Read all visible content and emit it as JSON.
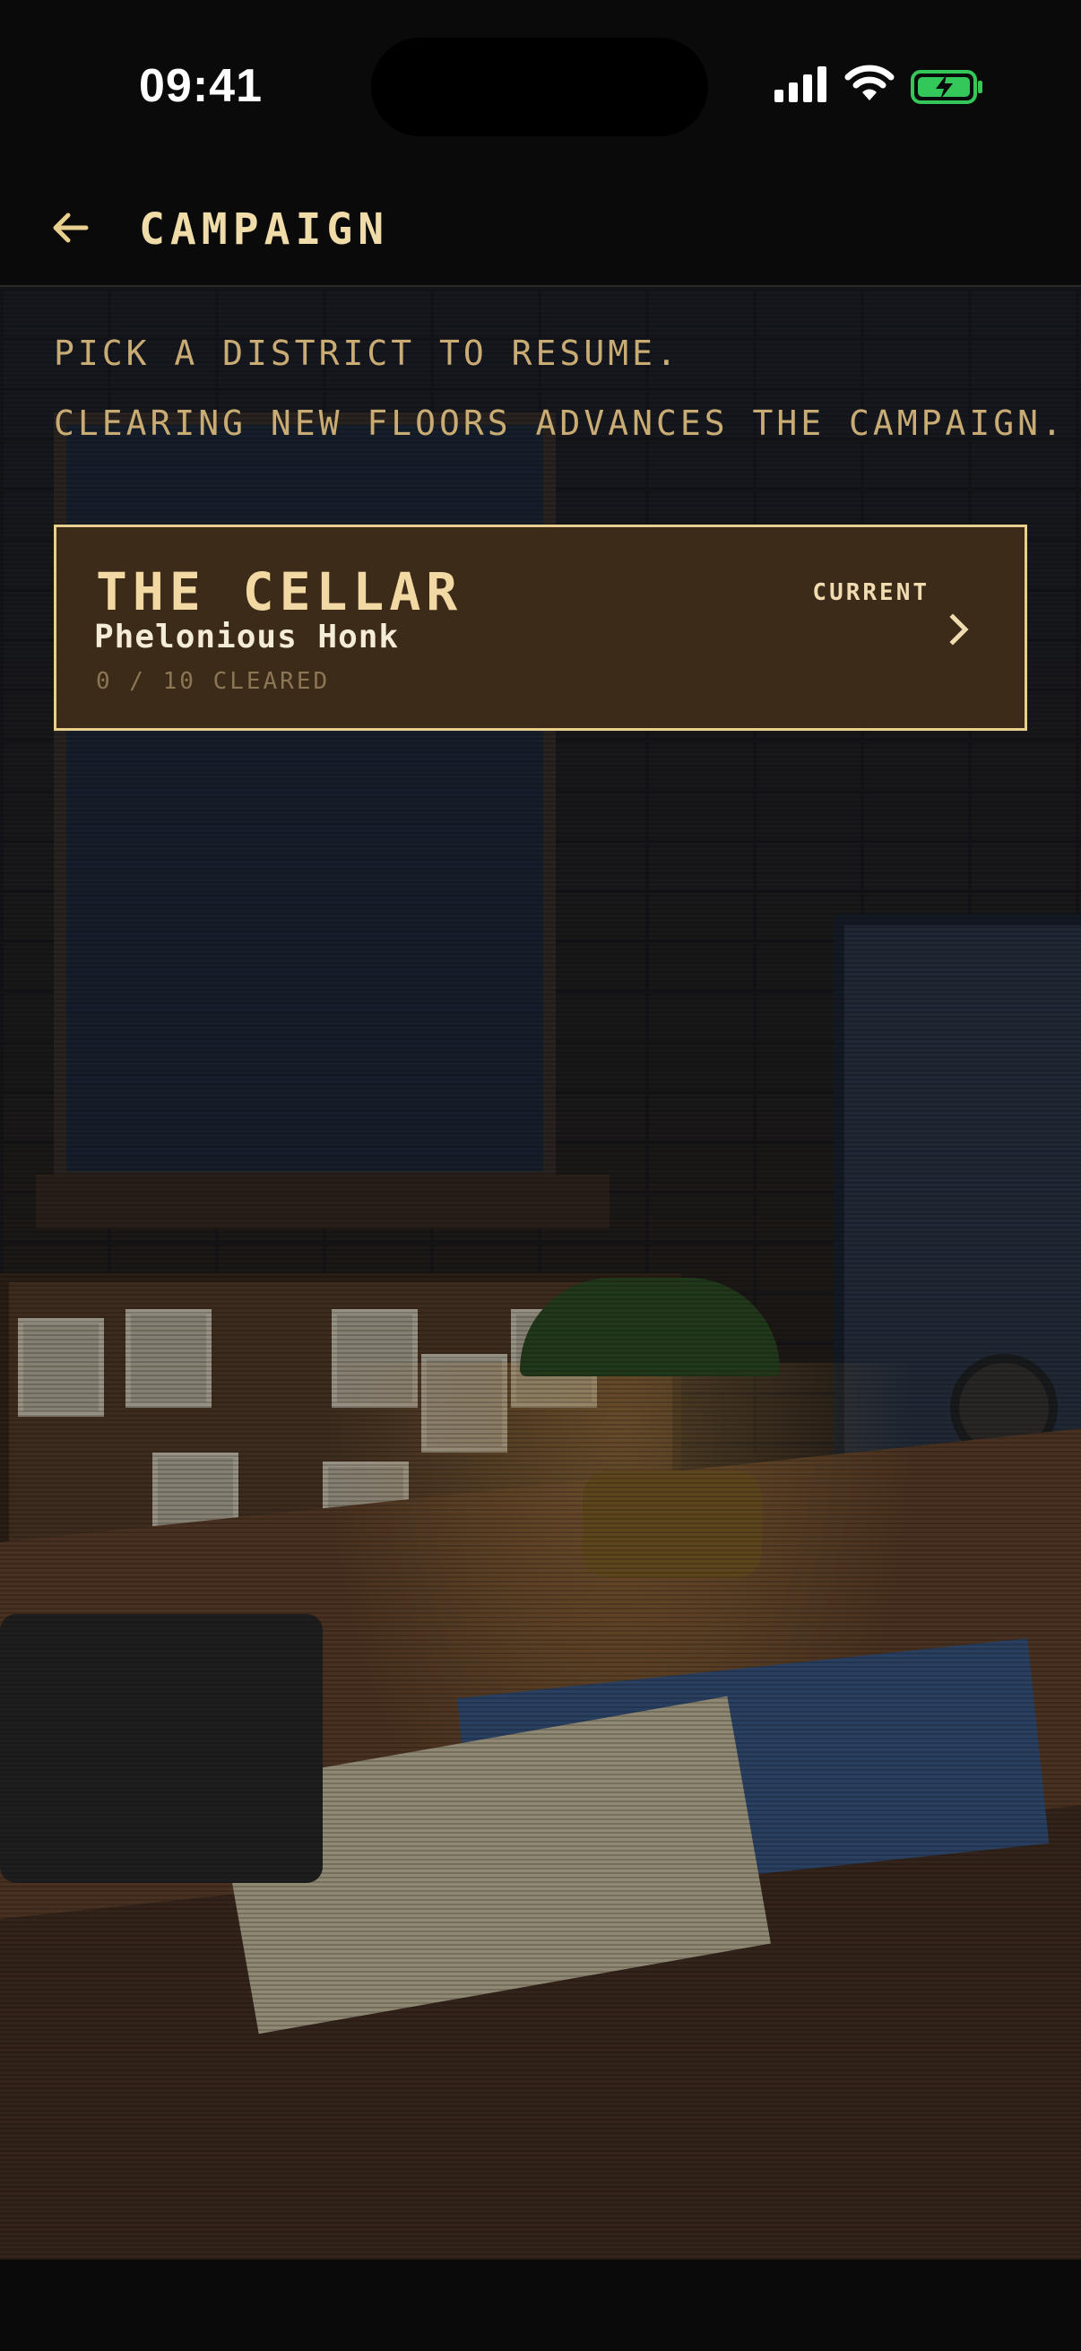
{
  "status": {
    "time": "09:41"
  },
  "header": {
    "title": "CAMPAIGN"
  },
  "intro": {
    "line1": "PICK A DISTRICT TO RESUME.",
    "line2": "CLEARING NEW FLOORS ADVANCES THE CAMPAIGN."
  },
  "districts": [
    {
      "name": "THE CELLAR",
      "boss": "Phelonious Honk",
      "progress": "0 / 10 CLEARED",
      "badge": "CURRENT"
    }
  ],
  "colors": {
    "accent": "#e8cf8e",
    "card_bg": "#3d2b1a",
    "battery": "#34c759"
  }
}
